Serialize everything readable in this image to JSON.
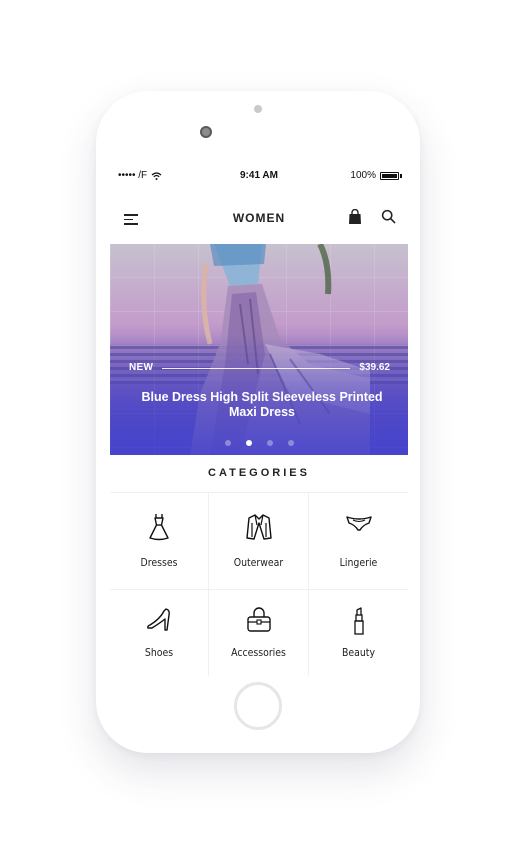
{
  "status_bar": {
    "carrier": "••••• /F",
    "time": "9:41 AM",
    "battery": "100%"
  },
  "nav": {
    "title": "WOMEN",
    "icons": [
      "menu-icon",
      "shopping-bag-icon",
      "search-icon"
    ]
  },
  "hero": {
    "badge": "NEW",
    "price": "$39.62",
    "title": "Blue Dress High Split Sleeveless Printed Maxi Dress",
    "slides": 4,
    "active_slide": 2
  },
  "categories": {
    "heading": "CATEGORIES",
    "items": [
      {
        "label": "Dresses",
        "icon": "dress-icon"
      },
      {
        "label": "Outerwear",
        "icon": "jacket-icon"
      },
      {
        "label": "Lingerie",
        "icon": "lingerie-icon"
      },
      {
        "label": "Shoes",
        "icon": "high-heel-icon"
      },
      {
        "label": "Accessories",
        "icon": "handbag-icon"
      },
      {
        "label": "Beauty",
        "icon": "lipstick-icon"
      }
    ]
  },
  "colors": {
    "hero_gradient_top": "#c39ccb",
    "hero_gradient_bottom": "#4b45c2",
    "text": "#222222",
    "divider": "#f0f0f2"
  }
}
